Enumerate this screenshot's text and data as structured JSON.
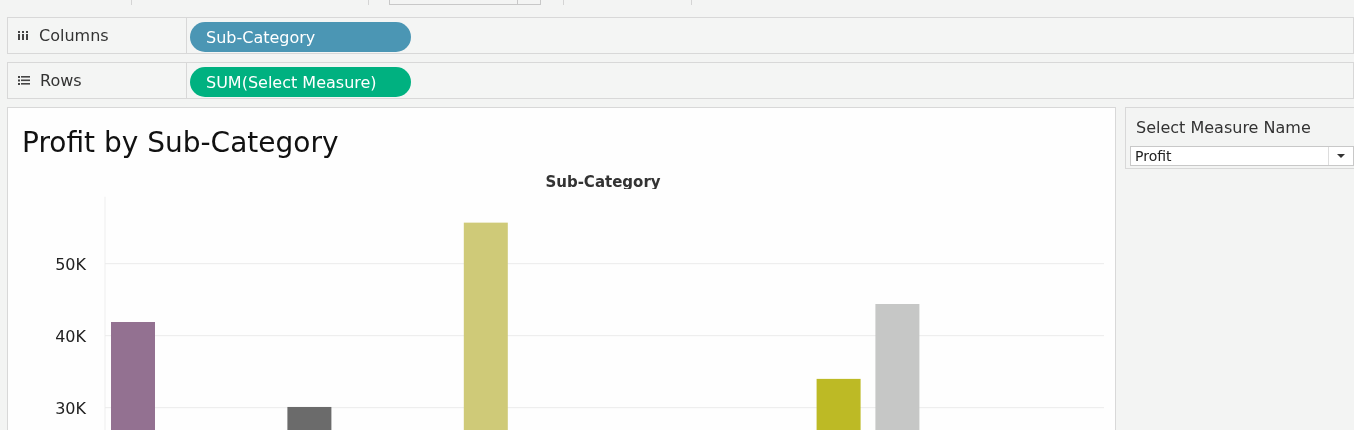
{
  "shelves": [
    {
      "kind": "columns",
      "label": "Columns",
      "pill": "Sub-Category",
      "color": "#4b96b4"
    },
    {
      "kind": "rows",
      "label": "Rows",
      "pill": "SUM(Select Measure)",
      "color": "#00b180"
    }
  ],
  "worksheet": {
    "title": "Profit by Sub-Category",
    "chart_data": {
      "type": "bar",
      "xlabel": "Sub-Category",
      "grid": true,
      "ylim": [
        26900,
        59300
      ],
      "yticks": [
        {
          "value": 30000,
          "label": "30K"
        },
        {
          "value": 40000,
          "label": "40K"
        },
        {
          "value": 50000,
          "label": "50K"
        }
      ],
      "series": [
        {
          "color": "#937191",
          "values": [
            41900,
            null,
            null,
            null,
            null,
            null,
            null,
            null,
            null,
            null,
            null,
            null,
            null,
            null,
            null,
            null,
            null
          ]
        },
        {
          "color": "#6b6b6b",
          "values": [
            null,
            null,
            null,
            30100,
            null,
            null,
            null,
            null,
            null,
            null,
            null,
            null,
            null,
            null,
            null,
            null,
            null
          ]
        },
        {
          "color": "#cfca78",
          "values": [
            null,
            null,
            null,
            null,
            null,
            null,
            55700,
            null,
            null,
            null,
            null,
            null,
            null,
            null,
            null,
            null,
            null
          ]
        },
        {
          "color": "#bdba25",
          "values": [
            null,
            null,
            null,
            null,
            null,
            null,
            null,
            null,
            null,
            null,
            null,
            null,
            34000,
            null,
            null,
            null,
            null
          ]
        },
        {
          "color": "#c6c7c6",
          "values": [
            null,
            null,
            null,
            null,
            null,
            null,
            null,
            null,
            null,
            null,
            null,
            null,
            null,
            44400,
            null,
            null,
            null
          ]
        }
      ]
    }
  },
  "parameter": {
    "title": "Select Measure Name",
    "value": "Profit"
  }
}
